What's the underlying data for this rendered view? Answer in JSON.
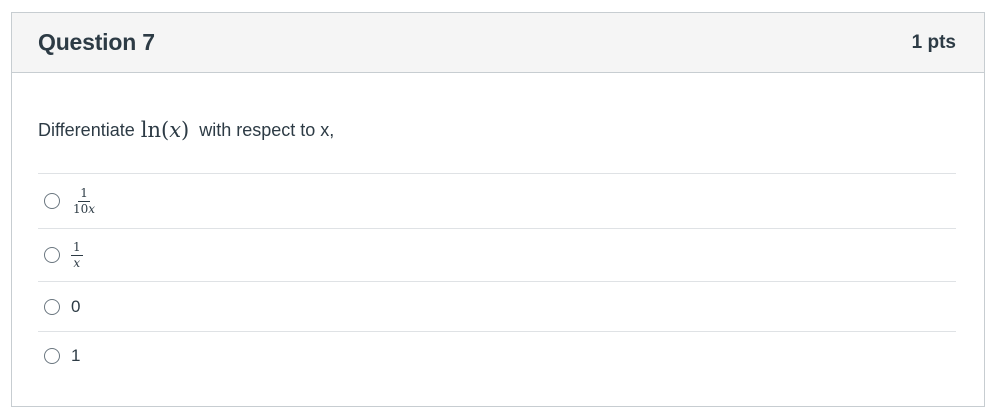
{
  "question": {
    "title": "Question 7",
    "points": "1 pts",
    "prompt_before": "Differentiate",
    "prompt_math_fn": "ln",
    "prompt_math_var": "x",
    "prompt_after": "with respect to x,"
  },
  "answers": [
    {
      "type": "fraction",
      "numerator": "1",
      "denominator_digits": "10",
      "denominator_var": "x"
    },
    {
      "type": "fraction",
      "numerator": "1",
      "denominator_digits": "",
      "denominator_var": "x"
    },
    {
      "type": "text",
      "label": "0"
    },
    {
      "type": "text",
      "label": "1"
    }
  ],
  "colors": {
    "text": "#2d3b45",
    "header_bg": "#f5f5f5",
    "border": "#c7cdd1"
  }
}
